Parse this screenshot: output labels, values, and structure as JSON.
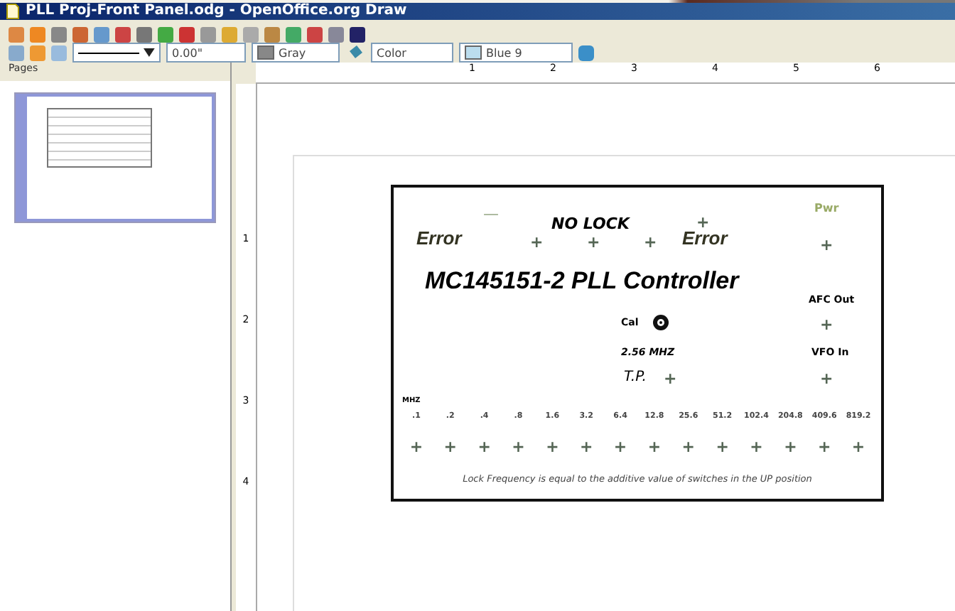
{
  "window": {
    "title": "PLL Proj-Front Panel.odg - OpenOffice.org Draw"
  },
  "line_toolbar": {
    "line_width": "0.00\"",
    "line_color": "Gray",
    "area_style": "Color",
    "area_fill": "Blue 9"
  },
  "pages_panel": {
    "title": "Pages",
    "thumbnails": [
      {
        "selected": true
      }
    ]
  },
  "ruler": {
    "horizontal": [
      "1",
      "2",
      "3",
      "4",
      "5",
      "6"
    ],
    "vertical": [
      "1",
      "2",
      "3",
      "4"
    ]
  },
  "drawing": {
    "no_lock": "NO LOCK",
    "minus": "—",
    "plus_top": "+",
    "pwr": "Pwr",
    "error_left": "Error",
    "error_plus": [
      "+",
      "+",
      "+"
    ],
    "error_right": "Error",
    "pwr_plus": "+",
    "title": "MC145151-2 PLL Controller",
    "afc_out": "AFC Out",
    "afc_plus": "+",
    "cal": "Cal",
    "freq": "2.56 MHZ",
    "vfo_in": "VFO In",
    "tp": "T.P.",
    "tp_plus": "+",
    "vfo_plus": "+",
    "unit": "MHZ",
    "switches": [
      {
        "value": ".1",
        "plus": "+"
      },
      {
        "value": ".2",
        "plus": "+"
      },
      {
        "value": ".4",
        "plus": "+"
      },
      {
        "value": ".8",
        "plus": "+"
      },
      {
        "value": "1.6",
        "plus": "+"
      },
      {
        "value": "3.2",
        "plus": "+"
      },
      {
        "value": "6.4",
        "plus": "+"
      },
      {
        "value": "12.8",
        "plus": "+"
      },
      {
        "value": "25.6",
        "plus": "+"
      },
      {
        "value": "51.2",
        "plus": "+"
      },
      {
        "value": "102.4",
        "plus": "+"
      },
      {
        "value": "204.8",
        "plus": "+"
      },
      {
        "value": "409.6",
        "plus": "+"
      },
      {
        "value": "819.2",
        "plus": "+"
      }
    ],
    "footer": "Lock Frequency is equal to the additive value of switches in the UP position"
  }
}
